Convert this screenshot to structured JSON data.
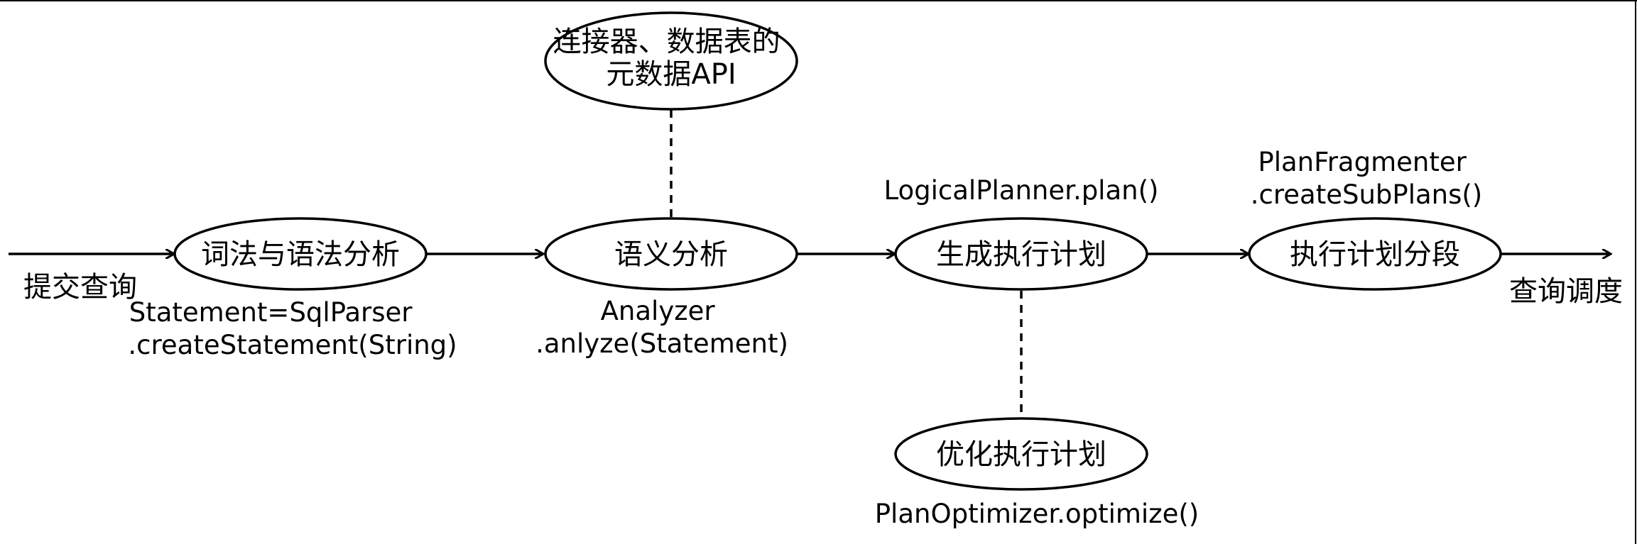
{
  "diagram": {
    "input_label": "提交查询",
    "output_label": "查询调度",
    "nodes": {
      "parse": {
        "label": "词法与语法分析",
        "caption": [
          "Statement=SqlParser",
          ".createStatement(String)"
        ]
      },
      "analyze": {
        "label": "语义分析",
        "caption": [
          "Analyzer",
          ".anlyze(Statement)"
        ]
      },
      "metadata": {
        "label": [
          "连接器、数据表的",
          "元数据API"
        ]
      },
      "plan": {
        "label": "生成执行计划",
        "caption": [
          "LogicalPlanner.plan()"
        ]
      },
      "optimize": {
        "label": "优化执行计划",
        "caption": [
          "PlanOptimizer.optimize()"
        ]
      },
      "fragment": {
        "label": "执行计划分段",
        "caption": [
          "PlanFragmenter",
          ".createSubPlans()"
        ]
      }
    }
  }
}
